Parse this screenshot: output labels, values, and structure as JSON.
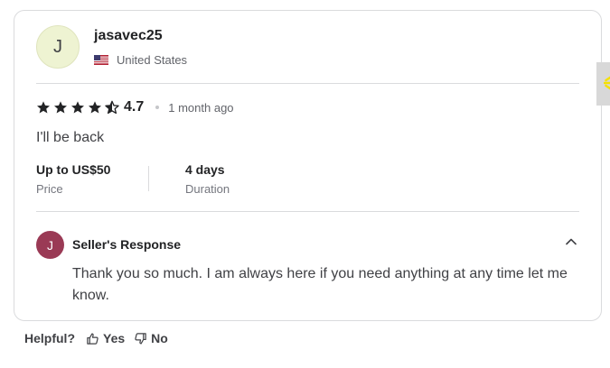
{
  "review": {
    "avatar_initial": "J",
    "username": "jasavec25",
    "country": "United States",
    "flag_icon": "us-flag-icon",
    "rating": "4.7",
    "stars_filled": 4.5,
    "stars_total": 5,
    "time_ago": "1 month ago",
    "text": "I'll be back",
    "price_value": "Up to US$50",
    "price_label": "Price",
    "duration_value": "4 days",
    "duration_label": "Duration"
  },
  "seller_response": {
    "avatar_initial": "J",
    "title": "Seller's Response",
    "text": "Thank you so much. I am always here if you need anything at any time let me know.",
    "toggle_icon": "chevron-up-icon"
  },
  "helpful": {
    "label": "Helpful?",
    "yes_label": "Yes",
    "no_label": "No"
  },
  "colors": {
    "seller_avatar": "#9a3a55",
    "reviewer_avatar": "#eef3d2",
    "divider": "#dadbdd",
    "side_tab_accent": "#f5e100"
  }
}
